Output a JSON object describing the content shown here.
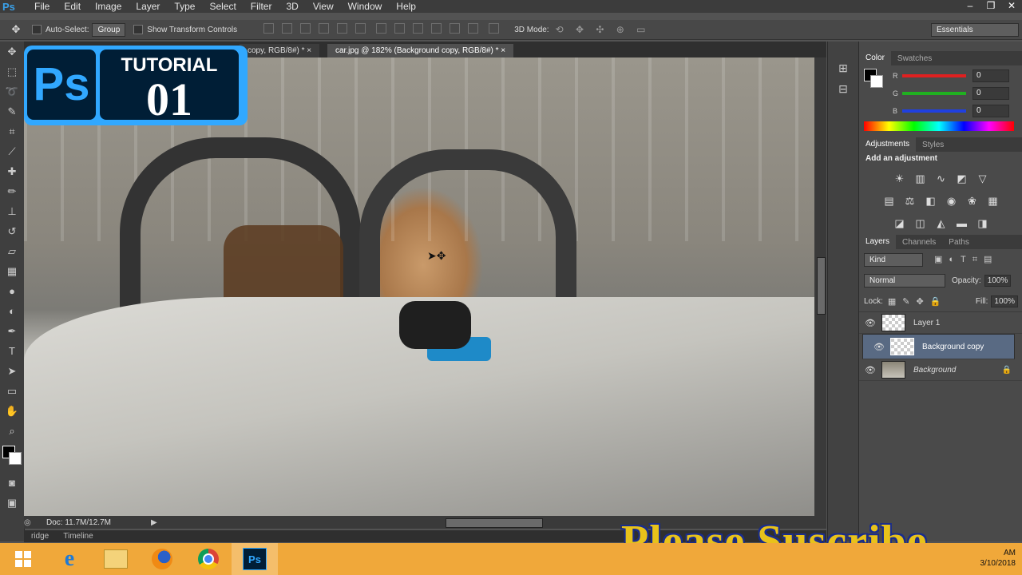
{
  "app": {
    "logo": "Ps"
  },
  "menu": [
    "File",
    "Edit",
    "Image",
    "Layer",
    "Type",
    "Select",
    "Filter",
    "3D",
    "View",
    "Window",
    "Help"
  ],
  "window_controls": [
    "–",
    "❐",
    "✕"
  ],
  "options_bar": {
    "auto_select_label": "Auto-Select:",
    "auto_select_value": "Group",
    "transform_label": "Show Transform Controls",
    "mode_3d_label": "3D Mode:",
    "workspace": "Essentials"
  },
  "doc_tabs": [
    {
      "label": "copy, RGB/8#) *"
    },
    {
      "label": "car.jpg @ 182% (Background copy, RGB/8#) *"
    }
  ],
  "status": {
    "doc": "Doc: 11.7M/12.7M"
  },
  "bottom_tabs": [
    "ridge",
    "Timeline"
  ],
  "color_panel": {
    "tabs": [
      "Color",
      "Swatches"
    ],
    "channels": [
      {
        "label": "R",
        "value": "0",
        "color": "#e02020"
      },
      {
        "label": "G",
        "value": "0",
        "color": "#20b020"
      },
      {
        "label": "B",
        "value": "0",
        "color": "#2040e0"
      }
    ]
  },
  "adjustments_panel": {
    "tabs": [
      "Adjustments",
      "Styles"
    ],
    "heading": "Add an adjustment"
  },
  "layers_panel": {
    "tabs": [
      "Layers",
      "Channels",
      "Paths"
    ],
    "kind": "Kind",
    "blend_mode": "Normal",
    "opacity_label": "Opacity:",
    "opacity_value": "100%",
    "lock_label": "Lock:",
    "fill_label": "Fill:",
    "fill_value": "100%",
    "layers": [
      {
        "name": "Layer 1",
        "selected": false
      },
      {
        "name": "Background copy",
        "selected": true
      },
      {
        "name": "Background",
        "selected": false
      }
    ]
  },
  "overlay": {
    "badge_logo": "Ps",
    "badge_title": "TUTORIAL",
    "badge_number": "01",
    "subscribe": "Please Suscribe"
  },
  "taskbar": {
    "time": "AM",
    "date": "3/10/2018"
  }
}
